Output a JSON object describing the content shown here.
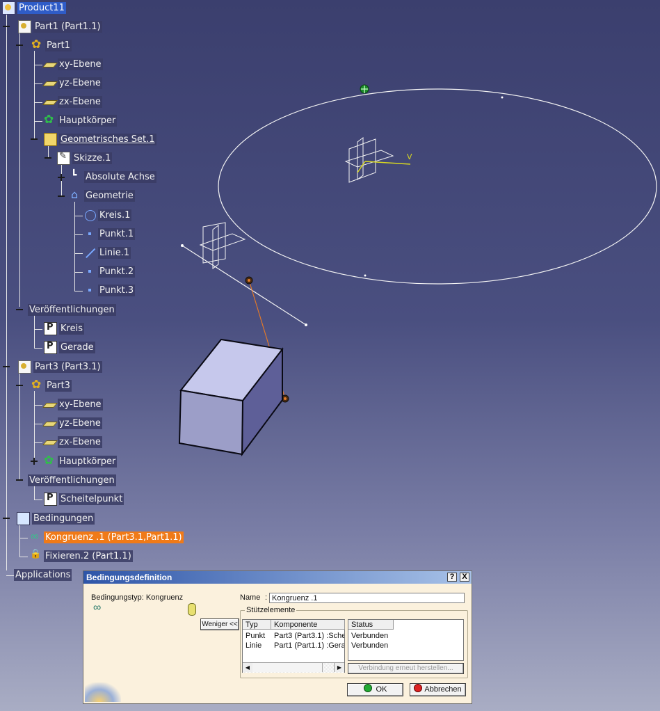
{
  "tree": {
    "root": "Product11",
    "part1_inst": "Part1 (Part1.1)",
    "part1": "Part1",
    "p1_xy": "xy-Ebene",
    "p1_yz": "yz-Ebene",
    "p1_zx": "zx-Ebene",
    "p1_body": "Hauptkörper",
    "geoset": "Geometrisches Set.1",
    "sketch": "Skizze.1",
    "abs_axis": "Absolute Achse",
    "geometry": "Geometrie",
    "kreis": "Kreis.1",
    "punkt1": "Punkt.1",
    "linie1": "Linie.1",
    "punkt2": "Punkt.2",
    "punkt3": "Punkt.3",
    "pub1": "Veröffentlichungen",
    "pub1_kreis": "Kreis",
    "pub1_gerade": "Gerade",
    "part3_inst": "Part3 (Part3.1)",
    "part3": "Part3",
    "p3_xy": "xy-Ebene",
    "p3_yz": "yz-Ebene",
    "p3_zx": "zx-Ebene",
    "p3_body": "Hauptkörper",
    "pub3": "Veröffentlichungen",
    "pub3_scheitel": "Scheitelpunkt",
    "constraints": "Bedingungen",
    "kongruenz": "Kongruenz .1 (Part3.1,Part1.1)",
    "fixieren": "Fixieren.2 (Part1.1)",
    "applications": "Applications"
  },
  "dialog": {
    "title": "Bedingungsdefinition",
    "help": "?",
    "close": "X",
    "type_label": "Bedingungstyp: Kongruenz",
    "name_label": "Name",
    "name_sep": ":",
    "name_value": "Kongruenz .1",
    "fewer_button": "Weniger <<",
    "support_group": "Stützelemente",
    "cols": [
      "Typ",
      "Komponente",
      "Status"
    ],
    "rows": [
      {
        "typ": "Punkt",
        "komp": "Part3 (Part3.1) :Sche",
        "status": "Verbunden"
      },
      {
        "typ": "Linie",
        "komp": "Part1 (Part1.1) :Gera",
        "status": "Verbunden"
      }
    ],
    "reconnect_button": "Verbindung erneut herstellen...",
    "ok_button": "OK",
    "cancel_button": "Abbrechen"
  },
  "colors": {
    "background_top": "#3b3f6e",
    "selection_blue": "#2f5cc8",
    "selection_orange": "#f07a18",
    "dialog_bg": "#fbf1dd",
    "titlebar": "#2e55a8"
  }
}
